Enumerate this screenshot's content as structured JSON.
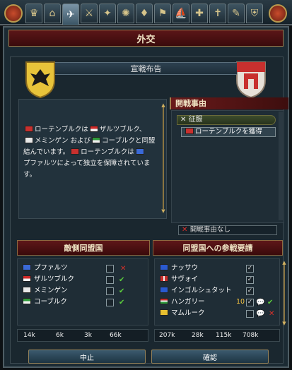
{
  "tabs": [
    {
      "icon": "court-icon"
    },
    {
      "icon": "building-icon"
    },
    {
      "icon": "dove-icon"
    },
    {
      "icon": "soldiers-icon"
    },
    {
      "icon": "goods-icon"
    },
    {
      "icon": "religion-icon"
    },
    {
      "icon": "bulb-icon"
    },
    {
      "icon": "flag-icon"
    },
    {
      "icon": "ship-icon"
    },
    {
      "icon": "tax-icon"
    },
    {
      "icon": "cross-icon"
    },
    {
      "icon": "scroll-icon"
    },
    {
      "icon": "shield-icon"
    }
  ],
  "window": {
    "title": "外交"
  },
  "declaration": {
    "subtitle": "宣戦布告"
  },
  "description": {
    "lines": [
      "ローテンブルクは",
      "ザルツブルク、",
      "メミンゲン および",
      "コーブルクと同盟",
      "結んでいます。",
      "ローテンブルクは",
      "プファルツによって独立を保障されていま",
      "す。"
    ]
  },
  "casus_belli": {
    "header": "開戦事由",
    "type": "征服",
    "target": "ローテンブルクを獲得",
    "none_label": "開戦事由なし"
  },
  "enemy_allies": {
    "title": "敵側同盟国",
    "rows": [
      {
        "name": "プファルツ",
        "status": "x"
      },
      {
        "name": "ザルツブルク",
        "status": "check"
      },
      {
        "name": "メミンゲン",
        "status": "check"
      },
      {
        "name": "コーブルク",
        "status": "check"
      }
    ],
    "stats": [
      "14k",
      "6k",
      "3k",
      "66k"
    ]
  },
  "call_allies": {
    "title": "同盟国への参戦要請",
    "rows": [
      {
        "name": "ナッサウ",
        "checked": true,
        "extra": ""
      },
      {
        "name": "サヴォイ",
        "checked": true,
        "extra": ""
      },
      {
        "name": "インゴルシュタット",
        "checked": true,
        "extra": ""
      },
      {
        "name": "ハンガリー",
        "checked": true,
        "extra": "10"
      },
      {
        "name": "マムルーク",
        "checked": false,
        "extra": ""
      }
    ],
    "stats": [
      "207k",
      "28k",
      "115k",
      "708k"
    ]
  },
  "buttons": {
    "cancel": "中止",
    "confirm": "確認"
  },
  "colors": {
    "accent_red": "#5e1719",
    "gold": "#b99a4e",
    "check": "#5ccd3c",
    "cross": "#d8302a"
  }
}
